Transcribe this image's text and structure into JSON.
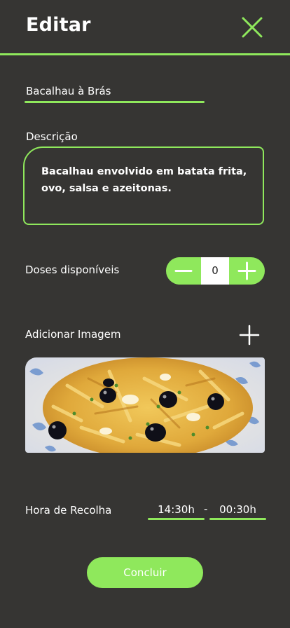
{
  "header": {
    "title": "Editar",
    "close_icon": "close-x-icon"
  },
  "form": {
    "name": {
      "value": "Bacalhau à Brás"
    },
    "description": {
      "label": "Descrição",
      "value": "Bacalhau envolvido em batata frita, ovo, salsa e azeitonas."
    },
    "doses": {
      "label": "Doses disponíveis",
      "value": "0"
    },
    "image": {
      "label": "Adicionar Imagem",
      "add_icon": "plus-icon"
    },
    "pickup": {
      "label": "Hora de Recolha",
      "start": "14:30h",
      "separator": "-",
      "end": "00:30h"
    },
    "submit_label": "Concluir"
  },
  "colors": {
    "background": "#363533",
    "accent": "#8fe85c",
    "text": "#ffffff"
  }
}
